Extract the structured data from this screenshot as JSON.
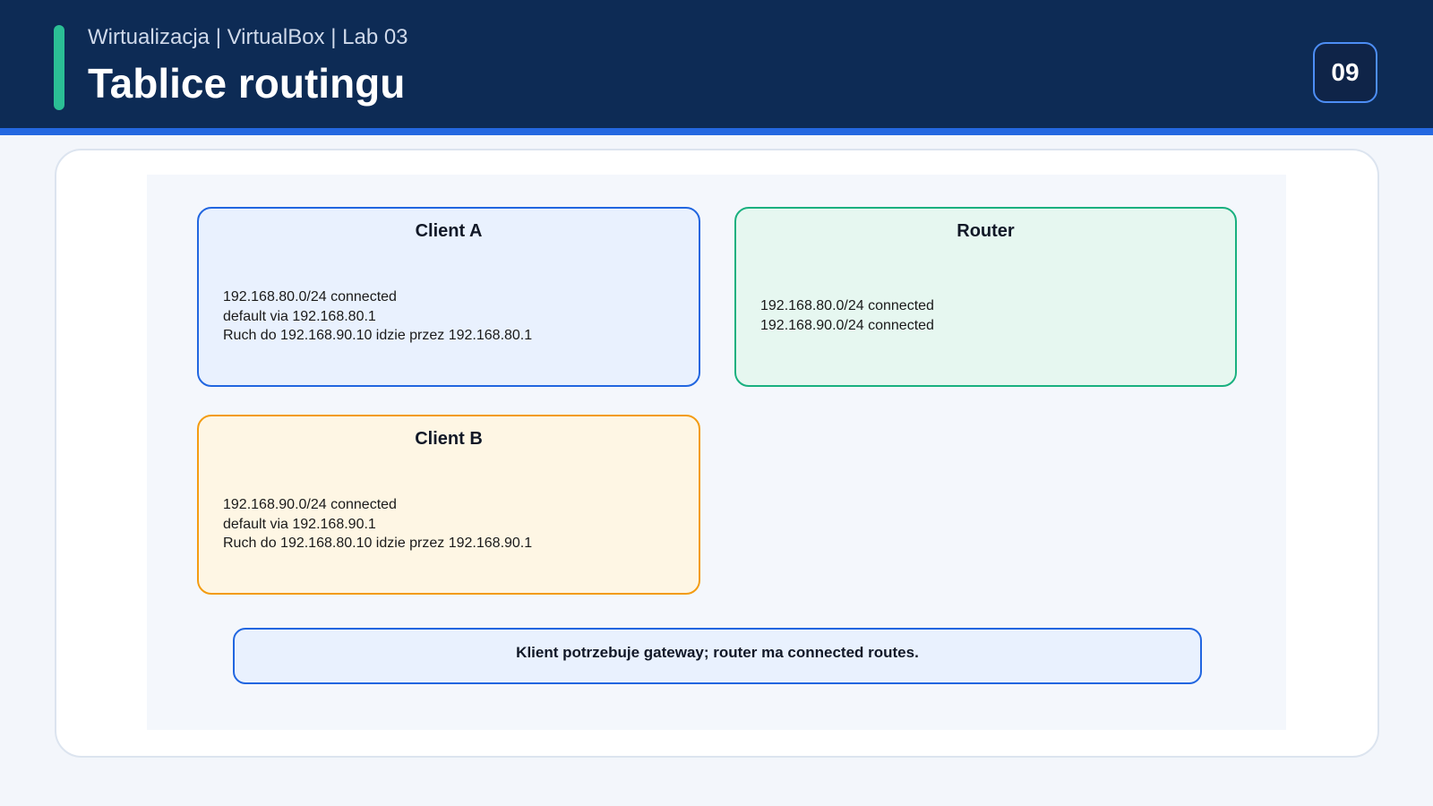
{
  "header": {
    "subtitle": "Wirtualizacja | VirtualBox | Lab 03",
    "title": "Tablice routingu",
    "slide_number": "09"
  },
  "diagram": {
    "boxes": [
      {
        "title": "Client A",
        "lines": [
          "192.168.80.0/24 connected",
          "default via 192.168.80.1",
          "Ruch do 192.168.90.10 idzie przez 192.168.80.1"
        ],
        "border_color": "#2166e0",
        "fill_color": "#e9f1fe"
      },
      {
        "title": "Router",
        "lines": [
          "192.168.80.0/24 connected",
          "192.168.90.0/24 connected"
        ],
        "border_color": "#19b07f",
        "fill_color": "#e6f7f0"
      },
      {
        "title": "Client B",
        "lines": [
          "192.168.90.0/24 connected",
          "default via 192.168.90.1",
          "Ruch do 192.168.80.10 idzie przez 192.168.90.1"
        ],
        "border_color": "#f39c12",
        "fill_color": "#fef6e4"
      }
    ],
    "note": "Klient potrzebuje gateway; router ma connected routes."
  },
  "colors": {
    "header_bg": "#0d2b55",
    "header_rule": "#2468e0",
    "accent": "#2bbf95"
  }
}
